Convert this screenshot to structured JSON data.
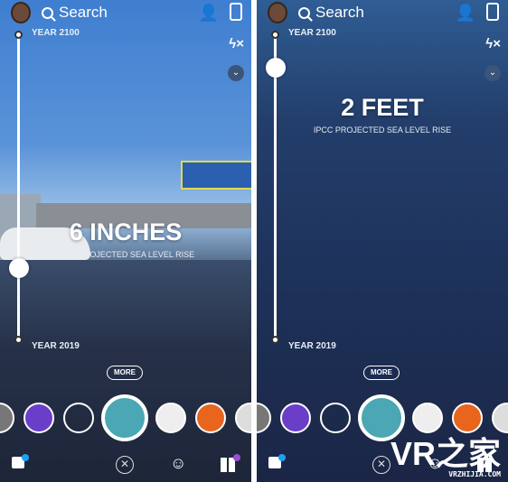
{
  "header": {
    "search_label": "Search",
    "add_friend_icon": "add-friend-icon",
    "flip_camera_icon": "flip-camera-icon",
    "flash_off_icon": "flash-off-icon",
    "chevron_icon": "chevron-down-icon"
  },
  "slider": {
    "top_label": "YEAR 2100",
    "bottom_label": "YEAR 2019"
  },
  "panels": [
    {
      "headline": "6 INCHES",
      "subtitle": "IPCC PROJECTED SEA LEVEL RISE",
      "slider_level": 0.23
    },
    {
      "headline": "2 FEET",
      "subtitle": "IPCC PROJECTED SEA LEVEL RISE",
      "slider_level": 0.89
    }
  ],
  "lens_carousel": {
    "more_label": "MORE"
  },
  "colors": {
    "chat_badge": "#1fa0f0",
    "stories_badge": "#9b4fd6",
    "lens_teal": "#4aa7b3"
  },
  "watermark": {
    "logo": "VR之家",
    "url": "VRZHIJIA.COM"
  }
}
